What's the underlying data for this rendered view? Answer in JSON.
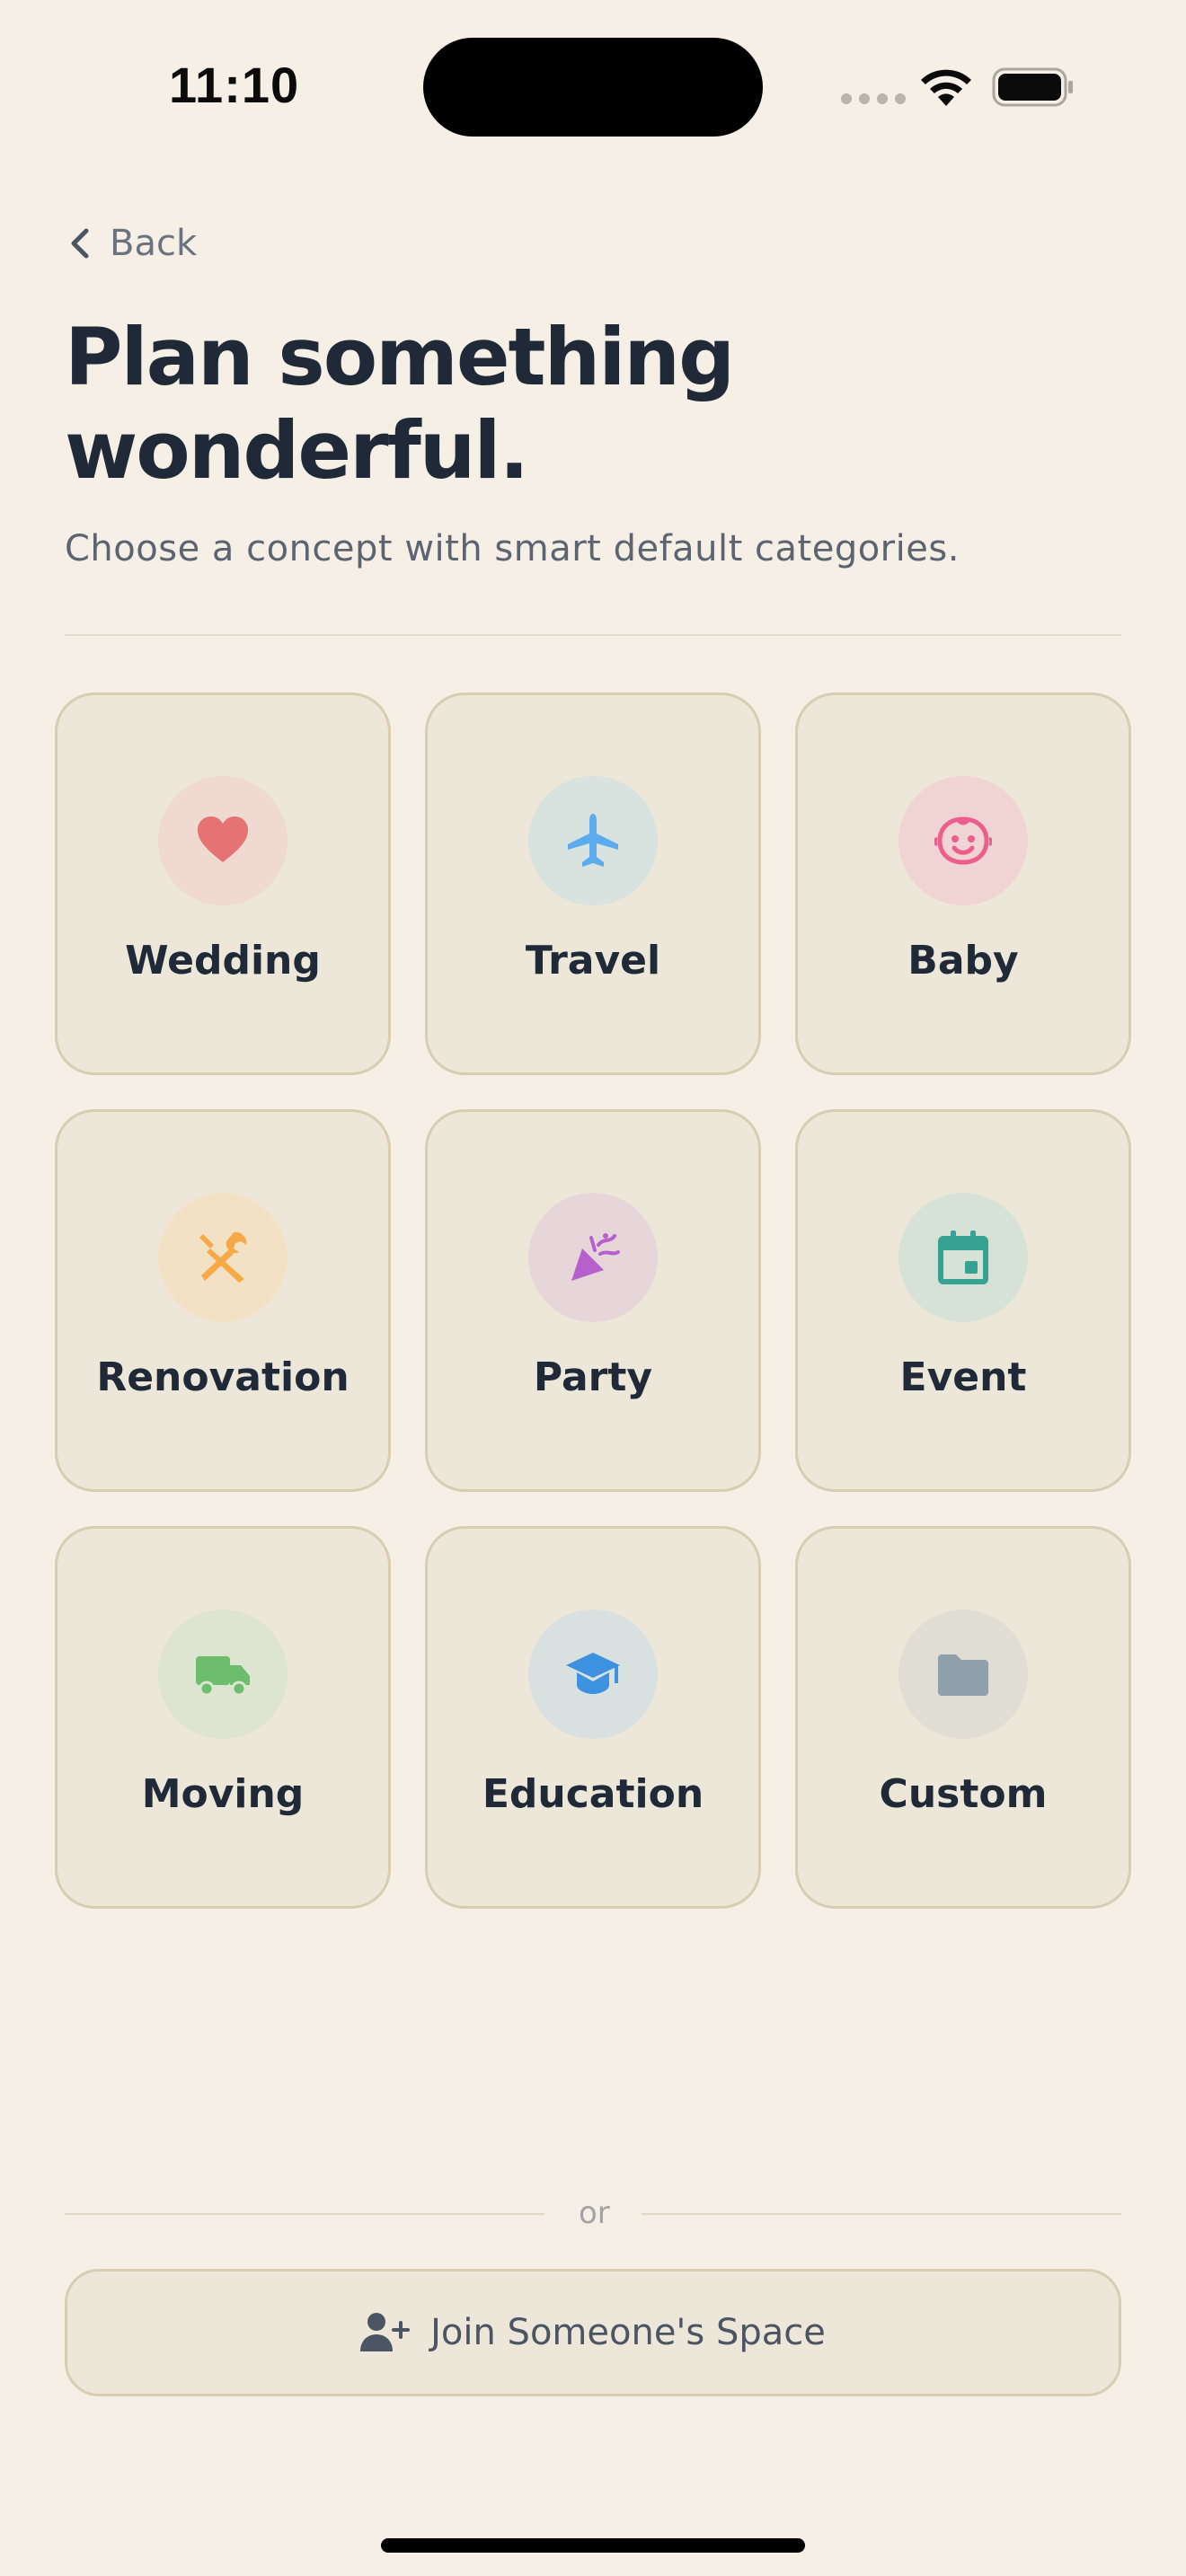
{
  "status_bar": {
    "time": "11:10"
  },
  "header": {
    "back_label": "Back",
    "title_line1": "Plan something",
    "title_line2": "wonderful.",
    "subtitle": "Choose a concept with smart default categories."
  },
  "concepts": [
    {
      "label": "Wedding",
      "icon": "heart-icon",
      "color": "#e57373",
      "bg": "#efd9d0"
    },
    {
      "label": "Travel",
      "icon": "airplane-icon",
      "color": "#5aacec",
      "bg": "#d8e2de"
    },
    {
      "label": "Baby",
      "icon": "baby-face-icon",
      "color": "#ec5f8d",
      "bg": "#f0d4d3"
    },
    {
      "label": "Renovation",
      "icon": "tools-icon",
      "color": "#f6a947",
      "bg": "#f3e1c6"
    },
    {
      "label": "Party",
      "icon": "party-popper-icon",
      "color": "#b75fcc",
      "bg": "#e7d6d9"
    },
    {
      "label": "Event",
      "icon": "calendar-icon",
      "color": "#36a392",
      "bg": "#d6e2d6"
    },
    {
      "label": "Moving",
      "icon": "truck-icon",
      "color": "#6dbd6f",
      "bg": "#dde4d0"
    },
    {
      "label": "Education",
      "icon": "graduation-cap-icon",
      "color": "#3d92e0",
      "bg": "#d8e0e0"
    },
    {
      "label": "Custom",
      "icon": "folder-icon",
      "color": "#8fa0ab",
      "bg": "#e0ddd5"
    }
  ],
  "separator": {
    "text": "or"
  },
  "join_button": {
    "label": "Join Someone's Space",
    "icon": "add-person-icon"
  }
}
